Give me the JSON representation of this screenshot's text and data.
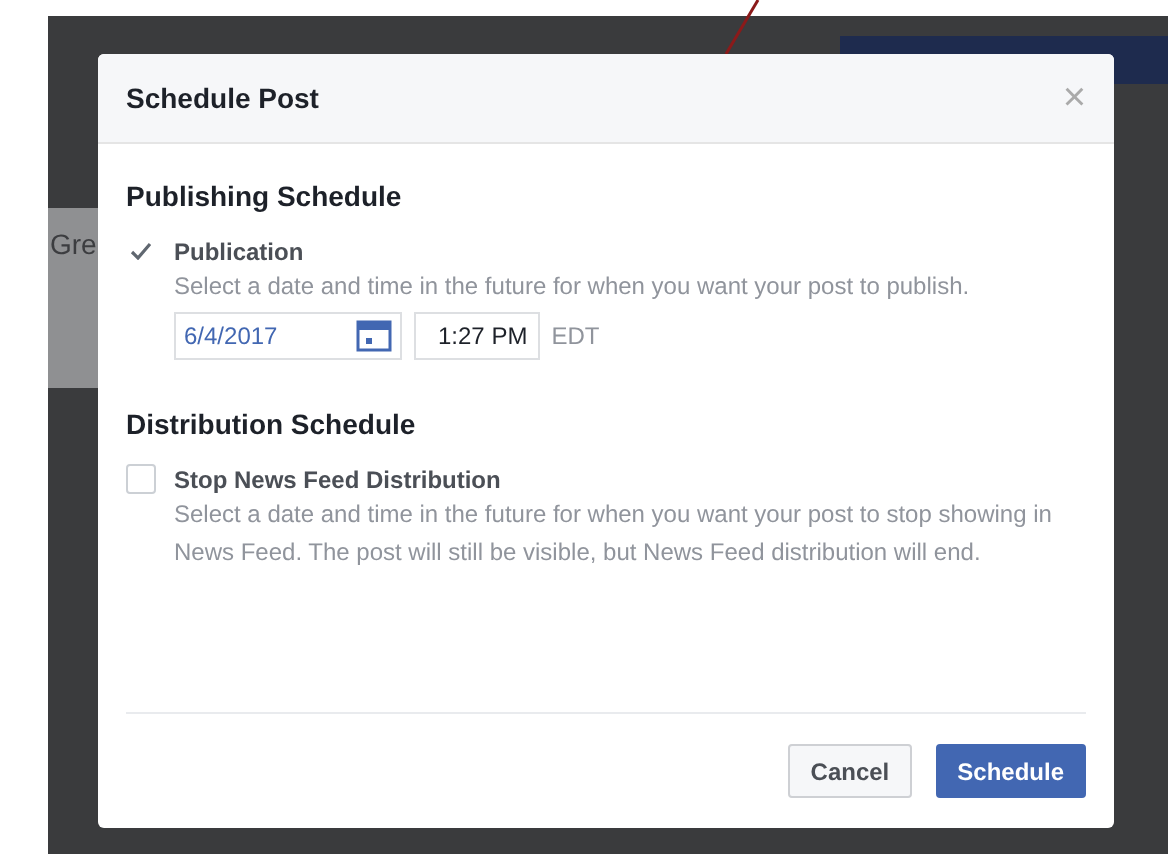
{
  "background": {
    "heading_fragment": "Gre"
  },
  "dialog": {
    "title": "Schedule Post",
    "close": "×",
    "sections": [
      {
        "heading": "Publishing Schedule",
        "option": {
          "label": "Publication",
          "checked": true
        },
        "description": "Select a date and time in the future for when you want your post to publish.",
        "date": "6/4/2017",
        "time": "1:27 PM",
        "timezone": "EDT"
      },
      {
        "heading": "Distribution Schedule",
        "option": {
          "label": "Stop News Feed Distribution",
          "checked": false
        },
        "description": "Select a date and time in the future for when you want your post to stop showing in News Feed. The post will still be visible, but News Feed distribution will end."
      }
    ],
    "buttons": [
      {
        "label": "Cancel",
        "kind": "secondary"
      },
      {
        "label": "Schedule",
        "kind": "primary"
      }
    ]
  }
}
